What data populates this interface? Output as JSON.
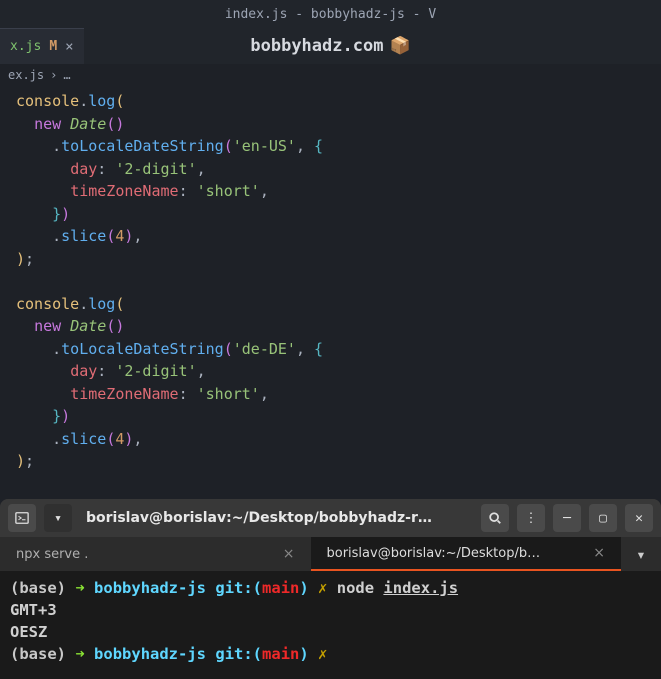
{
  "window": {
    "title": "index.js - bobbyhadz-js - V"
  },
  "tab": {
    "name": "x.js",
    "modified": "M",
    "close": "×"
  },
  "watermark": {
    "text": "bobbyhadz.com",
    "icon": "📦"
  },
  "breadcrumb": {
    "file": "ex.js",
    "sep": "›",
    "rest": "…"
  },
  "code": {
    "console": "console",
    "dot": ".",
    "log": "log",
    "lp": "(",
    "rp": ")",
    "new": "new",
    "date": "Date",
    "toLocale": "toLocaleDateString",
    "str_enUS": "'en-US'",
    "str_deDE": "'de-DE'",
    "comma": ",",
    "lb": "{",
    "rb": "}",
    "day": "day",
    "colon": ":",
    "str_2digit": "'2-digit'",
    "tz": "timeZoneName",
    "str_short": "'short'",
    "slice": "slice",
    "num4": "4",
    "semi": ";"
  },
  "terminal": {
    "title": "borislav@borislav:~/Desktop/bobbyhadz-r…",
    "tabs": {
      "t1": "npx serve .",
      "t2": "borislav@borislav:~/Desktop/b…"
    },
    "prompt": {
      "base": "(base)",
      "arrow": "➜",
      "dir": "bobbyhadz-js",
      "git": "git:(",
      "branch": "main",
      "gitend": ")",
      "dirty": "✗"
    },
    "cmd": {
      "node": "node",
      "file": "index.js"
    },
    "output": {
      "l1": "GMT+3",
      "l2": "OESZ"
    }
  }
}
